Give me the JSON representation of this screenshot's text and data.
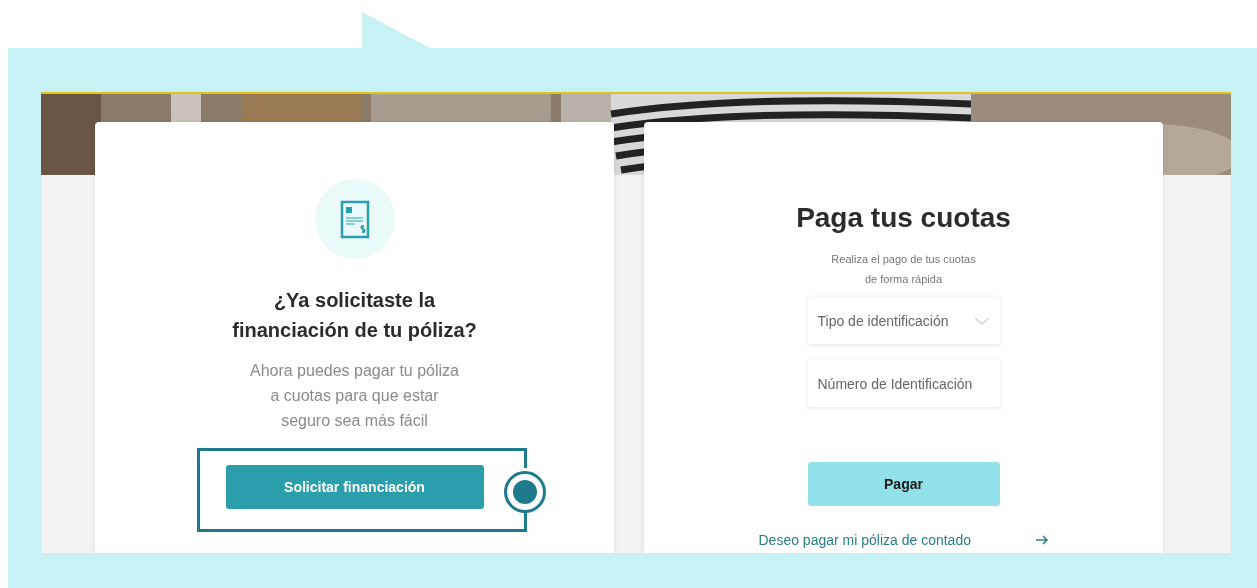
{
  "left_card": {
    "heading": "¿Ya solicitaste la\nfinanciación de tu póliza?",
    "description": "Ahora puedes pagar tu póliza\na cuotas para que estar\nseguro sea más fácil",
    "button": "Solicitar financiación",
    "highlighted": true
  },
  "right_card": {
    "title": "Paga tus cuotas",
    "subtitle": "Realiza el pago de tus cuotas\nde forma rápida",
    "fields": [
      {
        "kind": "select",
        "placeholder": "Tipo de identificación"
      },
      {
        "kind": "input",
        "placeholder": "Número de Identificación"
      }
    ],
    "button": "Pagar",
    "link": "Deseo pagar mi póliza de contado"
  }
}
